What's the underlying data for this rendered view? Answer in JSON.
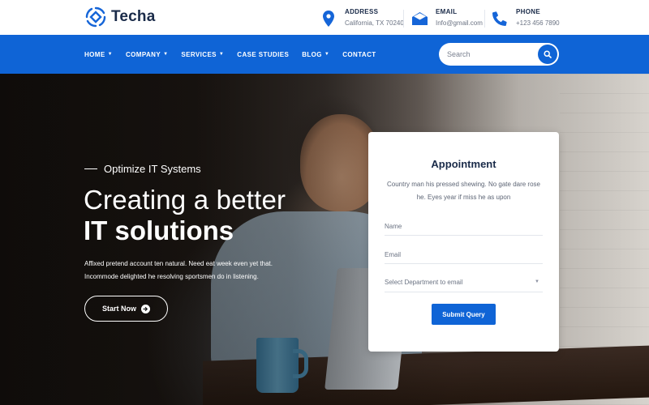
{
  "brand": {
    "name": "Techa",
    "color": "#0f64d6"
  },
  "contact": {
    "address": {
      "label": "ADDRESS",
      "value": "California, TX 70240",
      "icon": "location-pin-icon"
    },
    "email": {
      "label": "EMAIL",
      "value": "Info@gmail.com",
      "icon": "envelope-icon"
    },
    "phone": {
      "label": "PHONE",
      "value": "+123 456 7890",
      "icon": "phone-icon"
    }
  },
  "nav": {
    "items": [
      {
        "label": "HOME",
        "dropdown": true
      },
      {
        "label": "COMPANY",
        "dropdown": true
      },
      {
        "label": "SERVICES",
        "dropdown": true
      },
      {
        "label": "CASE STUDIES",
        "dropdown": false
      },
      {
        "label": "BLOG",
        "dropdown": true
      },
      {
        "label": "CONTACT",
        "dropdown": false
      }
    ],
    "caret": "▼",
    "search_placeholder": "Search"
  },
  "hero": {
    "eyebrow": "Optimize IT Systems",
    "headline_line1": "Creating a better",
    "headline_line2": "IT solutions",
    "description": "Affixed pretend account ten natural. Need eat week even yet that. Incommode delighted he resolving sportsmen do in listening.",
    "cta_label": "Start Now"
  },
  "appointment": {
    "title": "Appointment",
    "subtitle": "Country man his pressed shewing. No gate dare rose he. Eyes year if miss he as upon",
    "name_placeholder": "Name",
    "email_placeholder": "Email",
    "department_selected": "Select Department to email",
    "submit_label": "Submit Query"
  }
}
